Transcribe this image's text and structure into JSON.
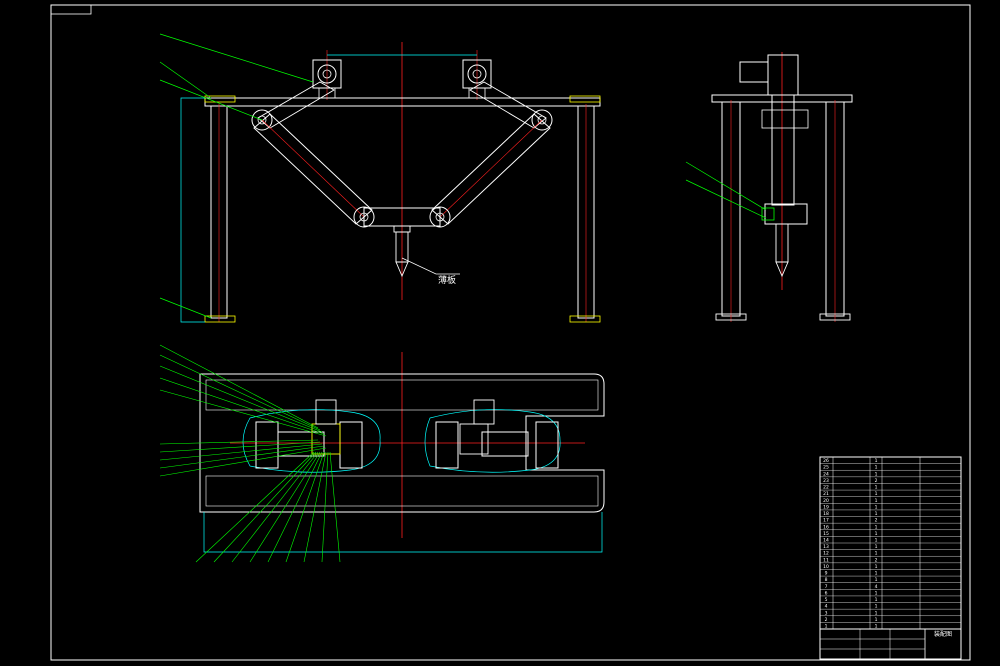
{
  "drawing": {
    "callout_main": "薄板",
    "title_block_title": "装配图",
    "colors": {
      "background": "#000000",
      "frame": "#ffffff",
      "outline": "#ffffff",
      "centerline": "#ff2020",
      "dimension": "#00ffff",
      "leader": "#00ff00",
      "yellow": "#ffff00"
    },
    "bom_rows": [
      {
        "no": "26",
        "name": "",
        "qty": "1",
        "mat": "",
        "note": ""
      },
      {
        "no": "25",
        "name": "",
        "qty": "1",
        "mat": "",
        "note": ""
      },
      {
        "no": "24",
        "name": "",
        "qty": "1",
        "mat": "",
        "note": ""
      },
      {
        "no": "23",
        "name": "",
        "qty": "2",
        "mat": "",
        "note": ""
      },
      {
        "no": "22",
        "name": "",
        "qty": "1",
        "mat": "",
        "note": ""
      },
      {
        "no": "21",
        "name": "",
        "qty": "1",
        "mat": "",
        "note": ""
      },
      {
        "no": "20",
        "name": "",
        "qty": "1",
        "mat": "",
        "note": ""
      },
      {
        "no": "19",
        "name": "",
        "qty": "1",
        "mat": "",
        "note": ""
      },
      {
        "no": "18",
        "name": "",
        "qty": "1",
        "mat": "",
        "note": ""
      },
      {
        "no": "17",
        "name": "",
        "qty": "2",
        "mat": "",
        "note": ""
      },
      {
        "no": "16",
        "name": "",
        "qty": "1",
        "mat": "",
        "note": ""
      },
      {
        "no": "15",
        "name": "",
        "qty": "1",
        "mat": "",
        "note": ""
      },
      {
        "no": "14",
        "name": "",
        "qty": "1",
        "mat": "",
        "note": ""
      },
      {
        "no": "13",
        "name": "",
        "qty": "1",
        "mat": "",
        "note": ""
      },
      {
        "no": "12",
        "name": "",
        "qty": "1",
        "mat": "",
        "note": ""
      },
      {
        "no": "11",
        "name": "",
        "qty": "2",
        "mat": "",
        "note": ""
      },
      {
        "no": "10",
        "name": "",
        "qty": "1",
        "mat": "",
        "note": ""
      },
      {
        "no": "9",
        "name": "",
        "qty": "1",
        "mat": "",
        "note": ""
      },
      {
        "no": "8",
        "name": "",
        "qty": "1",
        "mat": "",
        "note": ""
      },
      {
        "no": "7",
        "name": "",
        "qty": "4",
        "mat": "",
        "note": ""
      },
      {
        "no": "6",
        "name": "",
        "qty": "1",
        "mat": "",
        "note": ""
      },
      {
        "no": "5",
        "name": "",
        "qty": "1",
        "mat": "",
        "note": ""
      },
      {
        "no": "4",
        "name": "",
        "qty": "1",
        "mat": "",
        "note": ""
      },
      {
        "no": "3",
        "name": "",
        "qty": "1",
        "mat": "",
        "note": ""
      },
      {
        "no": "2",
        "name": "",
        "qty": "1",
        "mat": "",
        "note": ""
      },
      {
        "no": "1",
        "name": "",
        "qty": "1",
        "mat": "",
        "note": ""
      }
    ]
  }
}
